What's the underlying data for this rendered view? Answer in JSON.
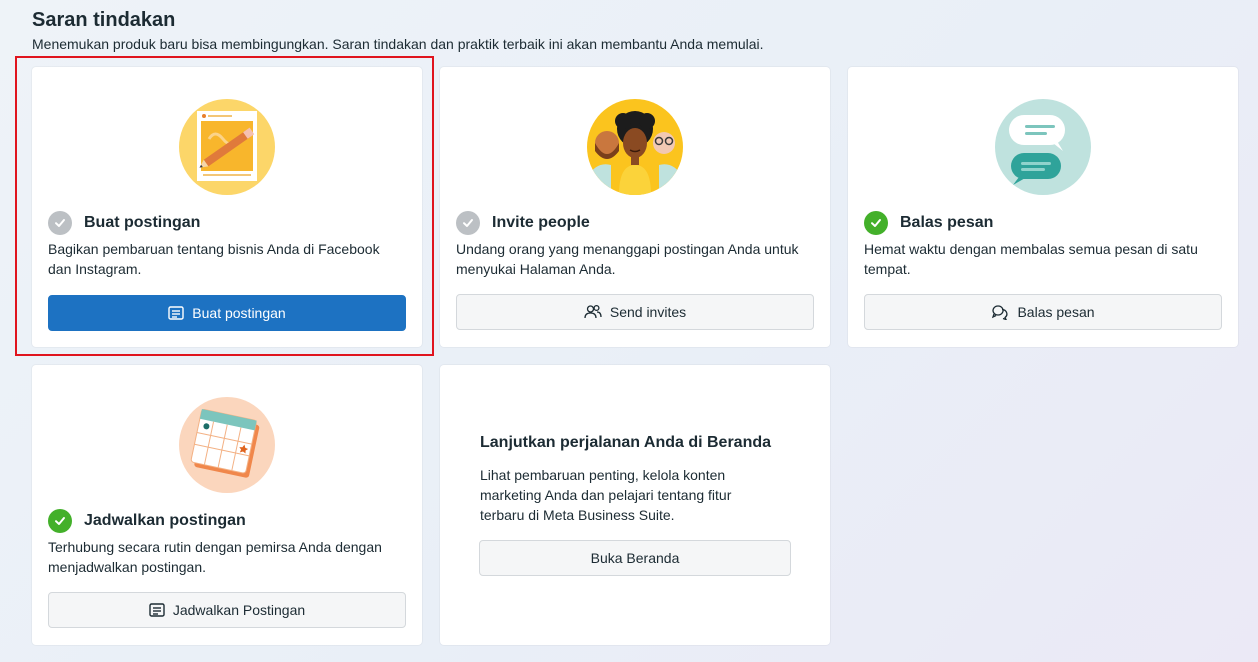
{
  "header": {
    "title": "Saran tindakan",
    "subtitle": "Menemukan produk baru bisa membingungkan. Saran tindakan dan praktik terbaik ini akan membantu Anda memulai."
  },
  "cards": [
    {
      "id": "create-post",
      "title": "Buat postingan",
      "description": "Bagikan pembaruan tentang bisnis Anda di Facebook dan Instagram.",
      "button_label": "Buat postingan",
      "status": "pending",
      "button_icon": "post-icon",
      "illustration": "post-pencil-illustration"
    },
    {
      "id": "invite-people",
      "title": "Invite people",
      "description": "Undang orang yang menanggapi postingan Anda untuk menyukai Halaman Anda.",
      "button_label": "Send invites",
      "status": "pending",
      "button_icon": "people-icon",
      "illustration": "people-illustration"
    },
    {
      "id": "reply-messages",
      "title": "Balas pesan",
      "description": "Hemat waktu dengan membalas semua pesan di satu tempat.",
      "button_label": "Balas pesan",
      "status": "done",
      "button_icon": "chat-icon",
      "illustration": "chat-bubbles-illustration"
    },
    {
      "id": "schedule-posts",
      "title": "Jadwalkan postingan",
      "description": "Terhubung secara rutin dengan pemirsa Anda dengan menjadwalkan postingan.",
      "button_label": "Jadwalkan Postingan",
      "status": "done",
      "button_icon": "post-icon",
      "illustration": "calendar-illustration"
    }
  ],
  "home_card": {
    "title": "Lanjutkan perjalanan Anda di Beranda",
    "description": "Lihat pembaruan penting, kelola konten marketing Anda dan pelajari tentang fitur terbaru di Meta Business Suite.",
    "button_label": "Buka Beranda"
  },
  "colors": {
    "primary_button": "#1d72c2",
    "check_done": "#43b02a",
    "check_pending": "#bcc0c4",
    "highlight": "#e0141e"
  }
}
